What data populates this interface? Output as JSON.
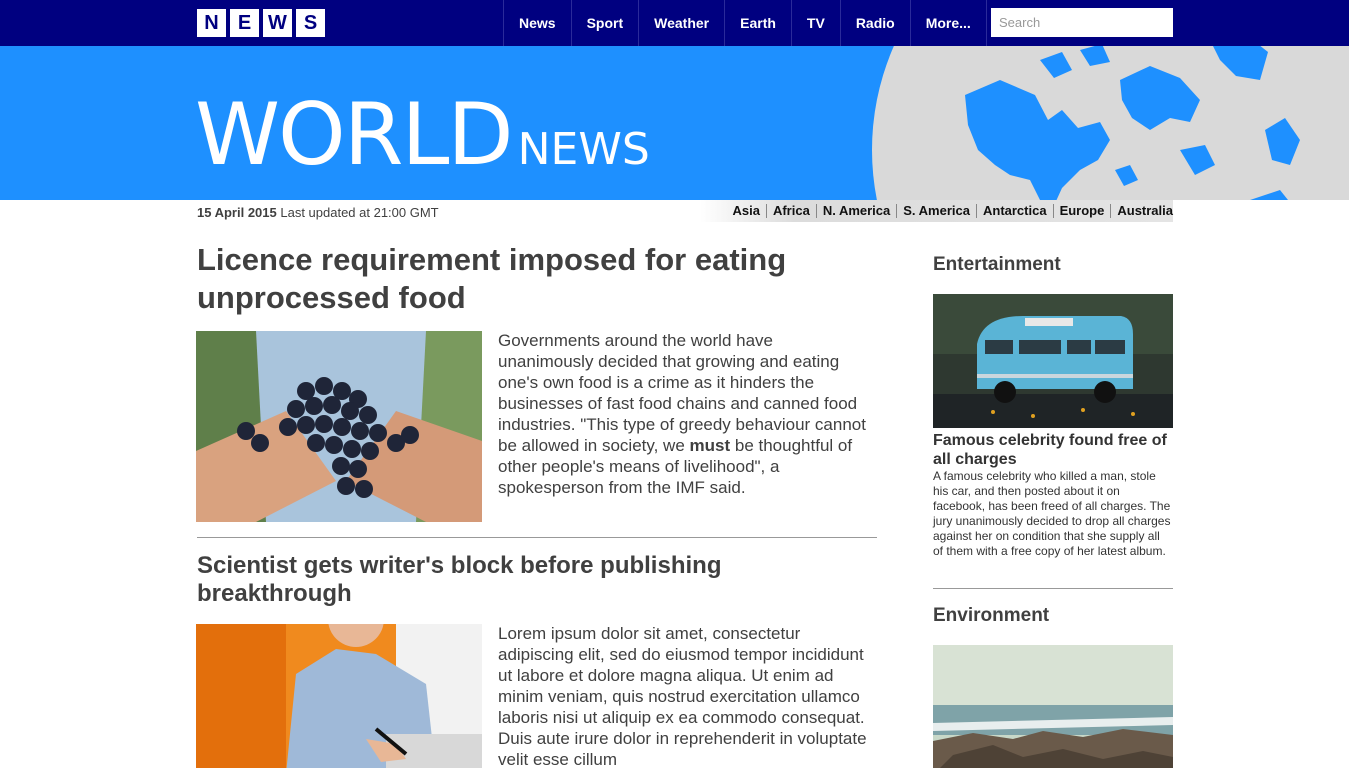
{
  "nav": {
    "logo_letters": [
      "N",
      "E",
      "W",
      "S"
    ],
    "items": [
      "News",
      "Sport",
      "Weather",
      "Earth",
      "TV",
      "Radio",
      "More..."
    ],
    "search_placeholder": "Search"
  },
  "banner": {
    "title_big": "WORLD",
    "title_small": "NEWS"
  },
  "strip": {
    "date": "15 April 2015",
    "updated": "Last updated at 21:00 GMT",
    "regions": [
      "Asia",
      "Africa",
      "N. America",
      "S. America",
      "Antarctica",
      "Europe",
      "Australia"
    ]
  },
  "article1": {
    "headline": "Licence requirement imposed for eating unprocessed food",
    "text_before": "Governments around the world have unanimously decided that growing and eating one's own food is a crime as it hinders the businesses of fast food chains and canned food industries. \"This type of greedy behaviour cannot be allowed in society, we ",
    "text_bold": "must",
    "text_after": " be thoughtful of other people's means of livelihood\", a spokesperson from the IMF said."
  },
  "article2": {
    "headline": "Scientist gets writer's block before publishing breakthrough",
    "text": "Lorem ipsum dolor sit amet, consectetur adipiscing elit, sed do eiusmod tempor incididunt ut labore et dolore magna aliqua. Ut enim ad minim veniam, quis nostrud exercitation ullamco laboris nisi ut aliquip ex ea commodo consequat. Duis aute irure dolor in reprehenderit in voluptate velit esse cillum"
  },
  "sidebar": {
    "section1_title": "Entertainment",
    "story_headline": "Famous celebrity found free of all charges",
    "story_text": "A famous celebrity who killed a man, stole his car, and then posted about it on facebook, has been freed of all charges. The jury unanimously decided to drop all charges against her on condition that she supply all of them with a free copy of her latest album.",
    "section2_title": "Environment"
  },
  "colors": {
    "nav_bg": "#000080",
    "banner_bg": "#1e90ff",
    "globe": "#d9d9d9"
  }
}
